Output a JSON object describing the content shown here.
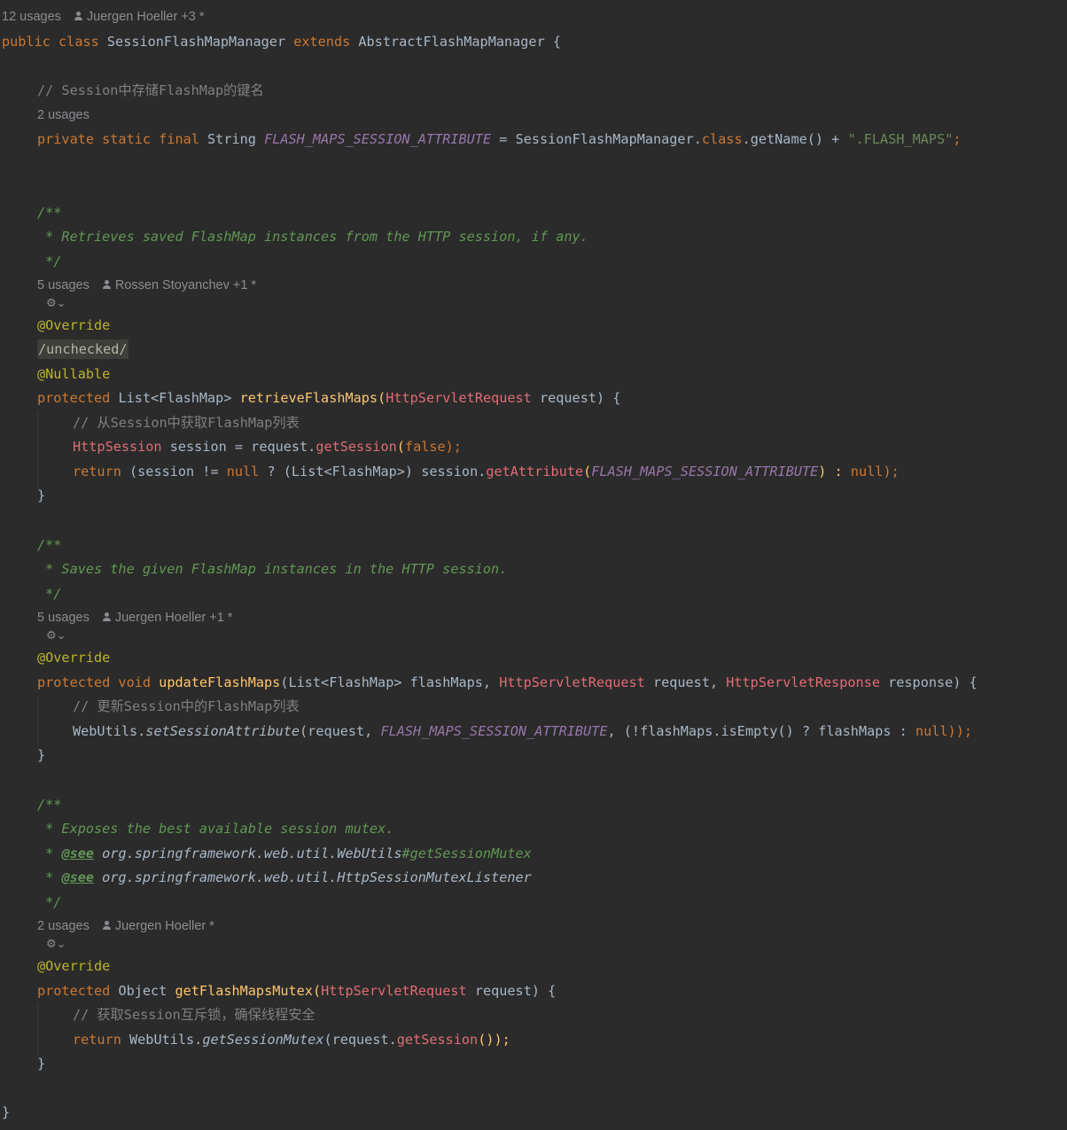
{
  "header": {
    "usages": "12 usages",
    "author": "Juergen Hoeller +3 *"
  },
  "class_decl": {
    "kw_public": "public",
    "kw_class": "class",
    "name": "SessionFlashMapManager",
    "kw_extends": "extends",
    "parent": "AbstractFlashMapManager",
    "brace": "{"
  },
  "field": {
    "comment": "// Session中存储FlashMap的键名",
    "usages": "2 usages",
    "mods": "private static final",
    "type": "String",
    "name": "FLASH_MAPS_SESSION_ATTRIBUTE",
    "eq": "=",
    "owner": "SessionFlashMapManager.",
    "kw_class": "class",
    "call": ".getName() +",
    "str": "\".FLASH_MAPS\"",
    "semi": ";"
  },
  "m1": {
    "doc_open": "/**",
    "doc_text": " * Retrieves saved FlashMap instances from the HTTP session, if any.",
    "doc_close": " */",
    "usages": "5 usages",
    "author": "Rossen Stoyanchev +1 *",
    "ann1": "@Override",
    "ann2": "/unchecked/",
    "ann3": "@Nullable",
    "sig_kw": "protected",
    "sig_ret": "List<FlashMap>",
    "sig_name": "retrieveFlashMaps",
    "sig_p_open": "(",
    "sig_ptype": "HttpServletRequest",
    "sig_pname": "request) {",
    "body_comment": "// 从Session中获取FlashMap列表",
    "l2_type": "HttpSession",
    "l2_rest": " session = request.",
    "l2_call": "getSession",
    "l2_arg_open": "(",
    "l2_false": "false",
    "l2_end": ");",
    "l3_return": "return",
    "l3_a": " (session != ",
    "l3_null1": "null",
    "l3_b": " ? (List<FlashMap>) session.",
    "l3_call": "getAttribute",
    "l3_c": "(",
    "l3_const": "FLASH_MAPS_SESSION_ATTRIBUTE",
    "l3_d": ") : ",
    "l3_null2": "null",
    "l3_e": ");",
    "close": "}"
  },
  "m2": {
    "doc_open": "/**",
    "doc_text": " * Saves the given FlashMap instances in the HTTP session.",
    "doc_close": " */",
    "usages": "5 usages",
    "author": "Juergen Hoeller +1 *",
    "ann1": "@Override",
    "sig_kw": "protected void",
    "sig_name": "updateFlashMaps",
    "sig_a": "(List<FlashMap> flashMaps, ",
    "sig_t1": "HttpServletRequest",
    "sig_b": " request, ",
    "sig_t2": "HttpServletResponse",
    "sig_c": " response) {",
    "body_comment": "// 更新Session中的FlashMap列表",
    "l2_a": "WebUtils.",
    "l2_call": "setSessionAttribute",
    "l2_b": "(request, ",
    "l2_const": "FLASH_MAPS_SESSION_ATTRIBUTE",
    "l2_c": ", (!flashMaps.isEmpty() ? flashMaps : ",
    "l2_null": "null",
    "l2_d": "));",
    "close": "}"
  },
  "m3": {
    "doc_open": "/**",
    "doc_text": " * Exposes the best available session mutex.",
    "doc_see_prefix": " * ",
    "doc_see_tag": "@see",
    "doc_see1_ref": " org.springframework.web.util.WebUtils",
    "doc_see1_hash": "#getSessionMutex",
    "doc_see2_ref": " org.springframework.web.util.HttpSessionMutexListener",
    "doc_close": " */",
    "usages": "2 usages",
    "author": "Juergen Hoeller *",
    "ann1": "@Override",
    "sig_kw": "protected",
    "sig_ret": "Object",
    "sig_name": "getFlashMapsMutex",
    "sig_p_open": "(",
    "sig_ptype": "HttpServletRequest",
    "sig_pname": " request) {",
    "body_comment": "// 获取Session互斥锁，确保线程安全",
    "l2_return": "return",
    "l2_a": " WebUtils.",
    "l2_call": "getSessionMutex",
    "l2_b": "(request.",
    "l2_call2": "getSession",
    "l2_c": "());",
    "close": "}"
  },
  "class_close": "}",
  "gutter_icon": "⚙⌄"
}
